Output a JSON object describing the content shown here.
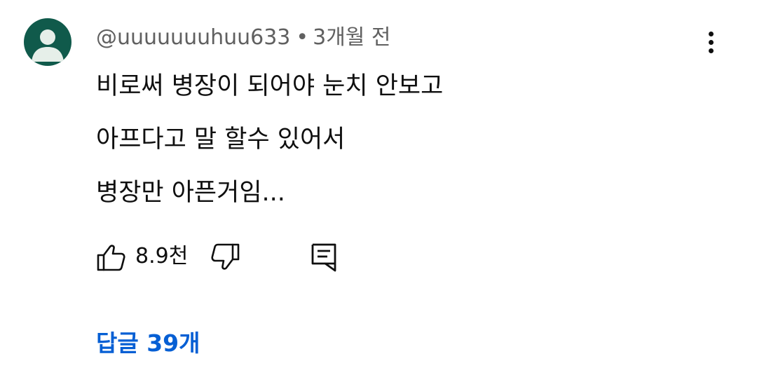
{
  "comment": {
    "author": "@uuuuuuuhuu633",
    "separator": "•",
    "timestamp": "3개월 전",
    "lines": [
      "비로써 병장이 되어야 눈치 안보고",
      "아프다고 말 할수 있어서",
      "병장만 아픈거임..."
    ],
    "avatar_color": "#105a4b"
  },
  "actions": {
    "like_icon": "thumbs-up-icon",
    "like_count": "8.9천",
    "dislike_icon": "thumbs-down-icon",
    "reply_icon": "comment-icon",
    "more_icon": "more-vertical-icon"
  },
  "replies": {
    "label": "답글 39개",
    "color": "#065fd4"
  }
}
